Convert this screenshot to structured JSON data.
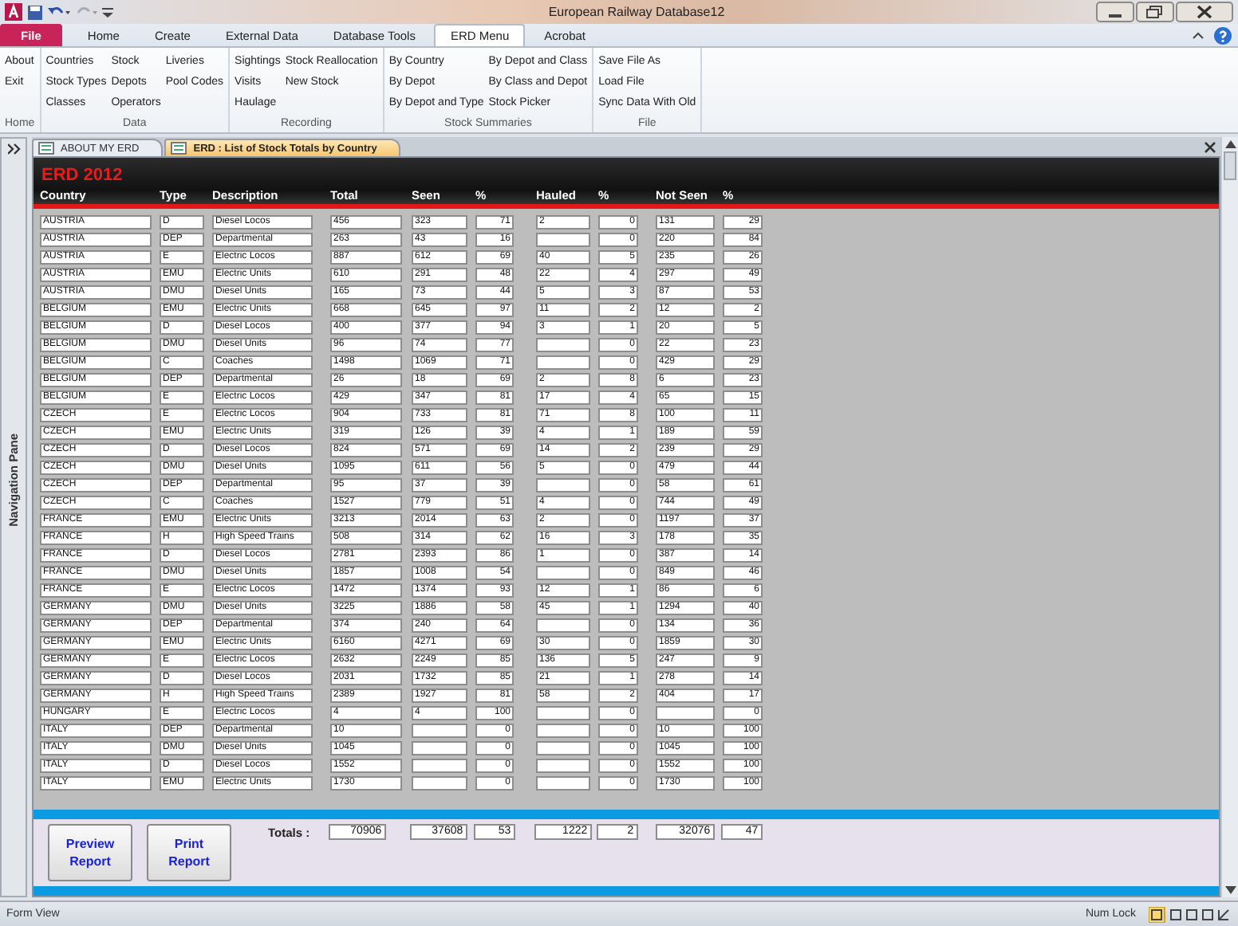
{
  "window": {
    "title": "European Railway Database12"
  },
  "ribbon_tabs": [
    {
      "label": "File",
      "kind": "file",
      "selected": false
    },
    {
      "label": "Home",
      "kind": "tab",
      "selected": false
    },
    {
      "label": "Create",
      "kind": "tab",
      "selected": false
    },
    {
      "label": "External Data",
      "kind": "tab",
      "selected": false
    },
    {
      "label": "Database Tools",
      "kind": "tab",
      "selected": false
    },
    {
      "label": "ERD Menu",
      "kind": "tab",
      "selected": true
    },
    {
      "label": "Acrobat",
      "kind": "tab",
      "selected": false
    }
  ],
  "ribbon_groups": [
    {
      "label": "Home",
      "columns": [
        [
          "About",
          "Exit"
        ]
      ]
    },
    {
      "label": "Data",
      "columns": [
        [
          "Countries",
          "Stock Types",
          "Classes"
        ],
        [
          "Stock",
          "Depots",
          "Operators"
        ],
        [
          "Liveries",
          "Pool Codes"
        ]
      ]
    },
    {
      "label": "Recording",
      "columns": [
        [
          "Sightings",
          "Visits",
          "Haulage"
        ],
        [
          "Stock Reallocation",
          "New Stock"
        ]
      ]
    },
    {
      "label": "Stock Summaries",
      "columns": [
        [
          "By Country",
          "By Depot",
          "By Depot and Type"
        ],
        [
          "By Depot and Class",
          "By Class and Depot",
          "Stock Picker"
        ]
      ]
    },
    {
      "label": "File",
      "columns": [
        [
          "Save File As",
          "Load File",
          "Sync Data With Old"
        ]
      ]
    }
  ],
  "navigation_pane": {
    "label": "Navigation Pane"
  },
  "document_tabs": [
    {
      "label": "ABOUT MY ERD",
      "selected": false
    },
    {
      "label": "ERD : List of Stock Totals by Country",
      "selected": true
    }
  ],
  "form": {
    "title": "ERD 2012",
    "columns": [
      "Country",
      "Type",
      "Description",
      "Total",
      "Seen",
      "%",
      "Hauled",
      "%",
      "Not Seen",
      "%"
    ],
    "rows": [
      {
        "country": "AUSTRIA",
        "type": "D",
        "description": "Diesel Locos",
        "total": "456",
        "seen": "323",
        "seen_pct": "71",
        "hauled": "2",
        "hauled_pct": "0",
        "not_seen": "131",
        "not_seen_pct": "29"
      },
      {
        "country": "AUSTRIA",
        "type": "DEP",
        "description": "Departmental",
        "total": "263",
        "seen": "43",
        "seen_pct": "16",
        "hauled_pct": "0",
        "not_seen": "220",
        "not_seen_pct": "84"
      },
      {
        "country": "AUSTRIA",
        "type": "E",
        "description": "Electric Locos",
        "total": "887",
        "seen": "612",
        "seen_pct": "69",
        "hauled": "40",
        "hauled_pct": "5",
        "not_seen": "235",
        "not_seen_pct": "26"
      },
      {
        "country": "AUSTRIA",
        "type": "EMU",
        "description": "Electric Units",
        "total": "610",
        "seen": "291",
        "seen_pct": "48",
        "hauled": "22",
        "hauled_pct": "4",
        "not_seen": "297",
        "not_seen_pct": "49"
      },
      {
        "country": "AUSTRIA",
        "type": "DMU",
        "description": "Diesel Units",
        "total": "165",
        "seen": "73",
        "seen_pct": "44",
        "hauled": "5",
        "hauled_pct": "3",
        "not_seen": "87",
        "not_seen_pct": "53"
      },
      {
        "country": "BELGIUM",
        "type": "EMU",
        "description": "Electric Units",
        "total": "668",
        "seen": "645",
        "seen_pct": "97",
        "hauled": "11",
        "hauled_pct": "2",
        "not_seen": "12",
        "not_seen_pct": "2"
      },
      {
        "country": "BELGIUM",
        "type": "D",
        "description": "Diesel Locos",
        "total": "400",
        "seen": "377",
        "seen_pct": "94",
        "hauled": "3",
        "hauled_pct": "1",
        "not_seen": "20",
        "not_seen_pct": "5"
      },
      {
        "country": "BELGIUM",
        "type": "DMU",
        "description": "Diesel Units",
        "total": "96",
        "seen": "74",
        "seen_pct": "77",
        "hauled_pct": "0",
        "not_seen": "22",
        "not_seen_pct": "23"
      },
      {
        "country": "BELGIUM",
        "type": "C",
        "description": "Coaches",
        "total": "1498",
        "seen": "1069",
        "seen_pct": "71",
        "hauled_pct": "0",
        "not_seen": "429",
        "not_seen_pct": "29"
      },
      {
        "country": "BELGIUM",
        "type": "DEP",
        "description": "Departmental",
        "total": "26",
        "seen": "18",
        "seen_pct": "69",
        "hauled": "2",
        "hauled_pct": "8",
        "not_seen": "6",
        "not_seen_pct": "23"
      },
      {
        "country": "BELGIUM",
        "type": "E",
        "description": "Electric Locos",
        "total": "429",
        "seen": "347",
        "seen_pct": "81",
        "hauled": "17",
        "hauled_pct": "4",
        "not_seen": "65",
        "not_seen_pct": "15"
      },
      {
        "country": "CZECH",
        "type": "E",
        "description": "Electric Locos",
        "total": "904",
        "seen": "733",
        "seen_pct": "81",
        "hauled": "71",
        "hauled_pct": "8",
        "not_seen": "100",
        "not_seen_pct": "11"
      },
      {
        "country": "CZECH",
        "type": "EMU",
        "description": "Electric Units",
        "total": "319",
        "seen": "126",
        "seen_pct": "39",
        "hauled": "4",
        "hauled_pct": "1",
        "not_seen": "189",
        "not_seen_pct": "59"
      },
      {
        "country": "CZECH",
        "type": "D",
        "description": "Diesel Locos",
        "total": "824",
        "seen": "571",
        "seen_pct": "69",
        "hauled": "14",
        "hauled_pct": "2",
        "not_seen": "239",
        "not_seen_pct": "29"
      },
      {
        "country": "CZECH",
        "type": "DMU",
        "description": "Diesel Units",
        "total": "1095",
        "seen": "611",
        "seen_pct": "56",
        "hauled": "5",
        "hauled_pct": "0",
        "not_seen": "479",
        "not_seen_pct": "44"
      },
      {
        "country": "CZECH",
        "type": "DEP",
        "description": "Departmental",
        "total": "95",
        "seen": "37",
        "seen_pct": "39",
        "hauled_pct": "0",
        "not_seen": "58",
        "not_seen_pct": "61"
      },
      {
        "country": "CZECH",
        "type": "C",
        "description": "Coaches",
        "total": "1527",
        "seen": "779",
        "seen_pct": "51",
        "hauled": "4",
        "hauled_pct": "0",
        "not_seen": "744",
        "not_seen_pct": "49"
      },
      {
        "country": "FRANCE",
        "type": "EMU",
        "description": "Electric Units",
        "total": "3213",
        "seen": "2014",
        "seen_pct": "63",
        "hauled": "2",
        "hauled_pct": "0",
        "not_seen": "1197",
        "not_seen_pct": "37"
      },
      {
        "country": "FRANCE",
        "type": "H",
        "description": "High Speed Trains",
        "total": "508",
        "seen": "314",
        "seen_pct": "62",
        "hauled": "16",
        "hauled_pct": "3",
        "not_seen": "178",
        "not_seen_pct": "35"
      },
      {
        "country": "FRANCE",
        "type": "D",
        "description": "Diesel Locos",
        "total": "2781",
        "seen": "2393",
        "seen_pct": "86",
        "hauled": "1",
        "hauled_pct": "0",
        "not_seen": "387",
        "not_seen_pct": "14"
      },
      {
        "country": "FRANCE",
        "type": "DMU",
        "description": "Diesel Units",
        "total": "1857",
        "seen": "1008",
        "seen_pct": "54",
        "hauled_pct": "0",
        "not_seen": "849",
        "not_seen_pct": "46"
      },
      {
        "country": "FRANCE",
        "type": "E",
        "description": "Electric Locos",
        "total": "1472",
        "seen": "1374",
        "seen_pct": "93",
        "hauled": "12",
        "hauled_pct": "1",
        "not_seen": "86",
        "not_seen_pct": "6"
      },
      {
        "country": "GERMANY",
        "type": "DMU",
        "description": "Diesel Units",
        "total": "3225",
        "seen": "1886",
        "seen_pct": "58",
        "hauled": "45",
        "hauled_pct": "1",
        "not_seen": "1294",
        "not_seen_pct": "40"
      },
      {
        "country": "GERMANY",
        "type": "DEP",
        "description": "Departmental",
        "total": "374",
        "seen": "240",
        "seen_pct": "64",
        "hauled_pct": "0",
        "not_seen": "134",
        "not_seen_pct": "36"
      },
      {
        "country": "GERMANY",
        "type": "EMU",
        "description": "Electric Units",
        "total": "6160",
        "seen": "4271",
        "seen_pct": "69",
        "hauled": "30",
        "hauled_pct": "0",
        "not_seen": "1859",
        "not_seen_pct": "30"
      },
      {
        "country": "GERMANY",
        "type": "E",
        "description": "Electric Locos",
        "total": "2632",
        "seen": "2249",
        "seen_pct": "85",
        "hauled": "136",
        "hauled_pct": "5",
        "not_seen": "247",
        "not_seen_pct": "9"
      },
      {
        "country": "GERMANY",
        "type": "D",
        "description": "Diesel Locos",
        "total": "2031",
        "seen": "1732",
        "seen_pct": "85",
        "hauled": "21",
        "hauled_pct": "1",
        "not_seen": "278",
        "not_seen_pct": "14"
      },
      {
        "country": "GERMANY",
        "type": "H",
        "description": "High Speed Trains",
        "total": "2389",
        "seen": "1927",
        "seen_pct": "81",
        "hauled": "58",
        "hauled_pct": "2",
        "not_seen": "404",
        "not_seen_pct": "17"
      },
      {
        "country": "HUNGARY",
        "type": "E",
        "description": "Electric Locos",
        "total": "4",
        "seen": "4",
        "seen_pct": "100",
        "hauled_pct": "0",
        "not_seen_pct": "0"
      },
      {
        "country": "ITALY",
        "type": "DEP",
        "description": "Departmental",
        "total": "10",
        "seen_pct": "0",
        "hauled_pct": "0",
        "not_seen": "10",
        "not_seen_pct": "100"
      },
      {
        "country": "ITALY",
        "type": "DMU",
        "description": "Diesel Units",
        "total": "1045",
        "seen_pct": "0",
        "hauled_pct": "0",
        "not_seen": "1045",
        "not_seen_pct": "100"
      },
      {
        "country": "ITALY",
        "type": "D",
        "description": "Diesel Locos",
        "total": "1552",
        "seen_pct": "0",
        "hauled_pct": "0",
        "not_seen": "1552",
        "not_seen_pct": "100"
      },
      {
        "country": "ITALY",
        "type": "EMU",
        "description": "Electric Units",
        "total": "1730",
        "seen_pct": "0",
        "hauled_pct": "0",
        "not_seen": "1730",
        "not_seen_pct": "100"
      }
    ],
    "buttons": [
      "Preview Report",
      "Print Report"
    ],
    "totals": {
      "label": "Totals :",
      "total": "70906",
      "seen": "37608",
      "seen_pct": "53",
      "hauled": "1222",
      "hauled_pct": "2",
      "not_seen": "32076",
      "not_seen_pct": "47"
    }
  },
  "status_bar": {
    "left": "Form View",
    "right": "Num Lock"
  }
}
